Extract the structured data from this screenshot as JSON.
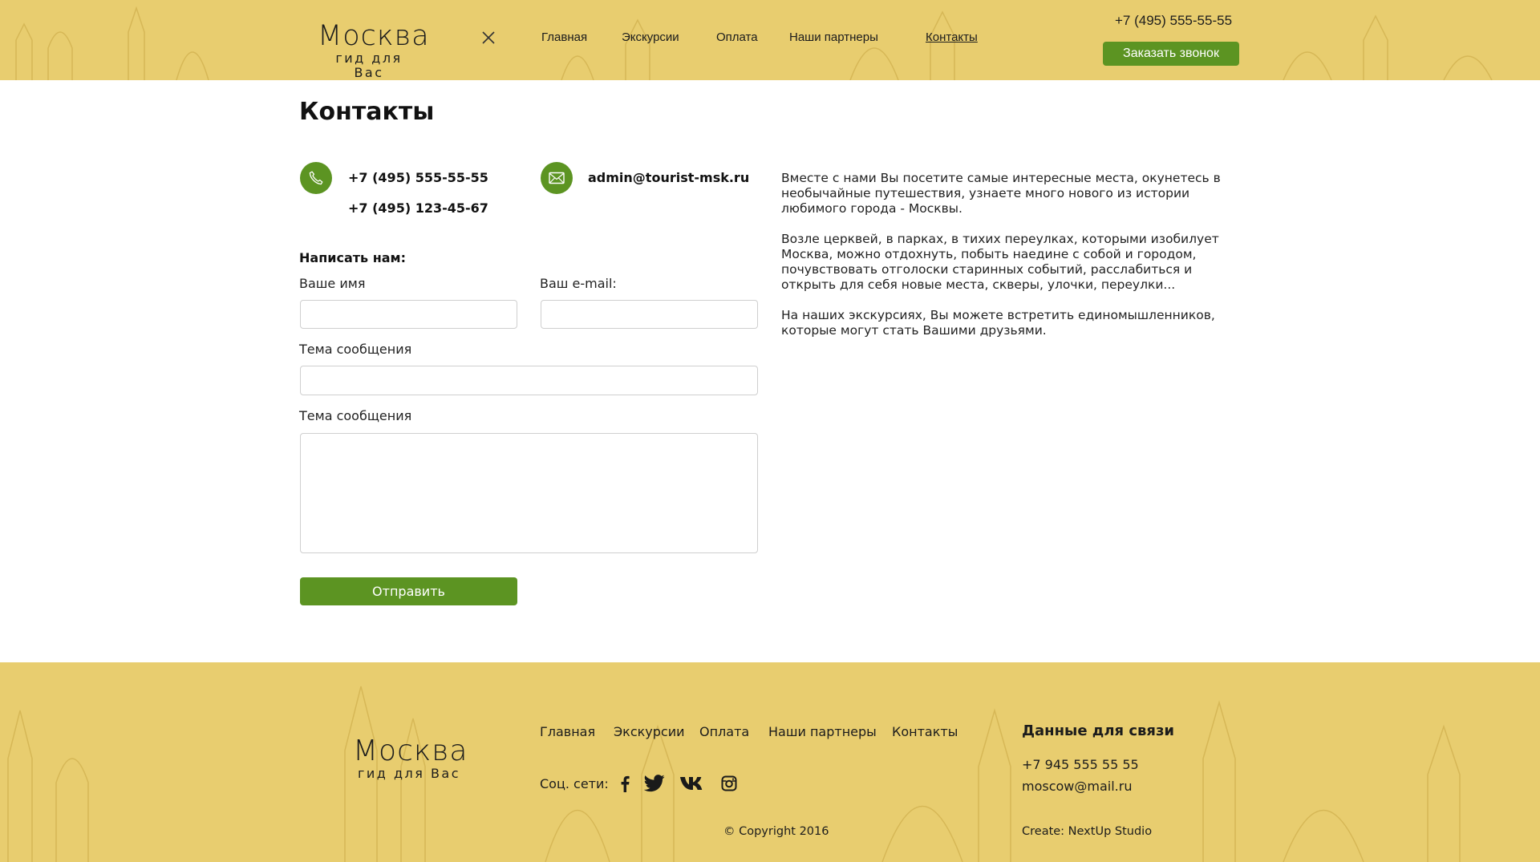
{
  "header": {
    "logo_city": "Москва",
    "logo_sub": "гид для Вас",
    "nav": [
      "Главная",
      "Экскурсии",
      "Оплата",
      "Наши партнеры",
      "Контакты"
    ],
    "active_nav": "Контакты",
    "phone": "+7 (495) 555-55-55",
    "callback_label": "Заказать звонок"
  },
  "main": {
    "title": "Контакты",
    "phone_1": "+7 (495) 555-55-55",
    "phone_2": "+7 (495) 123-45-67",
    "email": "admin@tourist-msk.ru",
    "form": {
      "heading": "Написать нам:",
      "name_label": "Ваше имя",
      "email_label": "Ваш e-mail:",
      "subject_label": "Тема сообщения",
      "message_label": "Тема сообщения",
      "name_value": "",
      "email_value": "",
      "subject_value": "",
      "message_value": "",
      "submit_label": "Отправить"
    },
    "about": [
      "Вместе с нами Вы посетите самые интересные места, окунетесь в необычайные путешествия, узнаете много нового из истории любимого города - Москвы.",
      "Возле церквей, в парках, в тихих переулках, которыми изобилует Москва, можно отдохнуть, побыть наедине с собой и городом, почувствовать отголоски старинных событий, расслабиться и открыть для себя новые места, скверы, улочки, переулки...",
      "На наших экскурсиях, Вы можете встретить единомышленников, которые могут стать Вашими друзьями."
    ]
  },
  "footer": {
    "logo_city": "Москва",
    "logo_sub": "гид для Вас",
    "nav": [
      "Главная",
      "Экскурсии",
      "Оплата",
      "Наши партнеры",
      "Контакты"
    ],
    "social_label": "Соц. сети:",
    "social_icons": [
      "facebook-icon",
      "twitter-icon",
      "vk-icon",
      "instagram-icon"
    ],
    "copyright": "© Copyright 2016",
    "contact_heading": "Данные для связи",
    "contact_phone": "+7 945 555 55 55",
    "contact_email": "moscow@mail.ru",
    "credit": "Create: NextUp Studio"
  },
  "colors": {
    "accent": "#5c9422",
    "band": "#e8cd6f"
  }
}
